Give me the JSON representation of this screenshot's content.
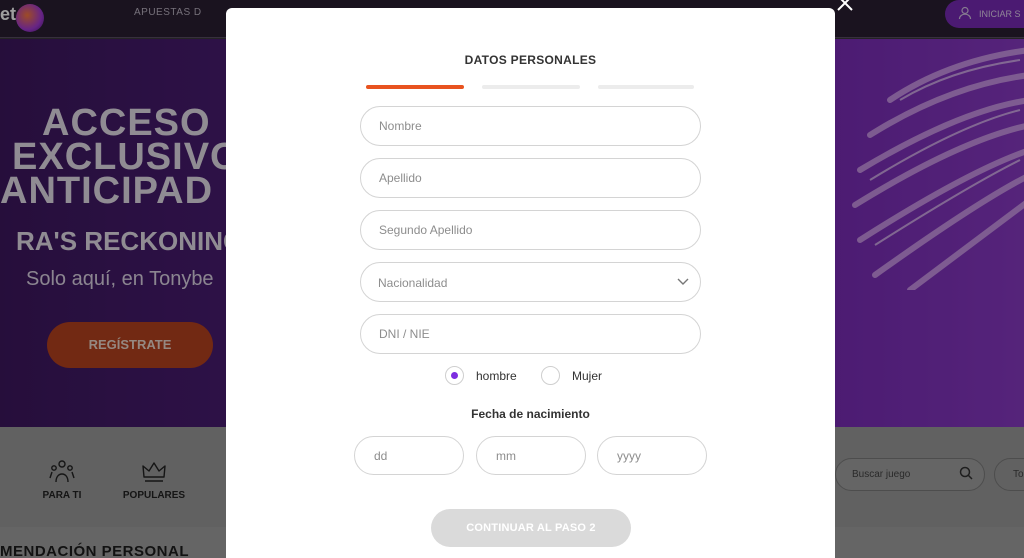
{
  "background": {
    "logo_text": "et",
    "nav_item": "APUESTAS D",
    "login_button": "INICIAR S",
    "hero": {
      "line1": "ACCESO",
      "line2": "EXCLUSIVO",
      "line3": "ANTICIPAD",
      "subtitle": "RA'S RECKONING",
      "tagline": "Solo aquí, en Tonybe",
      "register_button": "REGÍSTRATE"
    },
    "categories": [
      {
        "label": "PARA TI",
        "icon": "trophy-people-icon"
      },
      {
        "label": "POPULARES",
        "icon": "crown-icon"
      }
    ],
    "search_placeholder": "Buscar juego",
    "pill_label": "To",
    "section_title": "MENDACIÓN PERSONAL"
  },
  "modal": {
    "title": "DATOS PERSONALES",
    "steps": [
      {
        "state": "active",
        "color": "#e8531f"
      },
      {
        "state": "inactive",
        "color": "#ececec"
      },
      {
        "state": "inactive",
        "color": "#ececec"
      }
    ],
    "fields": {
      "nombre_placeholder": "Nombre",
      "apellido_placeholder": "Apellido",
      "segundo_apellido_placeholder": "Segundo Apellido",
      "nacionalidad_label": "Nacionalidad",
      "dni_placeholder": "DNI / NIE"
    },
    "gender": {
      "options": [
        "hombre",
        "Mujer"
      ],
      "selected": "hombre"
    },
    "dob": {
      "label": "Fecha de nacimiento",
      "dd_placeholder": "dd",
      "mm_placeholder": "mm",
      "yyyy_placeholder": "yyyy"
    },
    "continue_button": "CONTINUAR AL PASO 2"
  },
  "colors": {
    "accent_orange": "#e8531f",
    "radio_purple": "#7d2ee0",
    "button_disabled": "#dadada"
  }
}
